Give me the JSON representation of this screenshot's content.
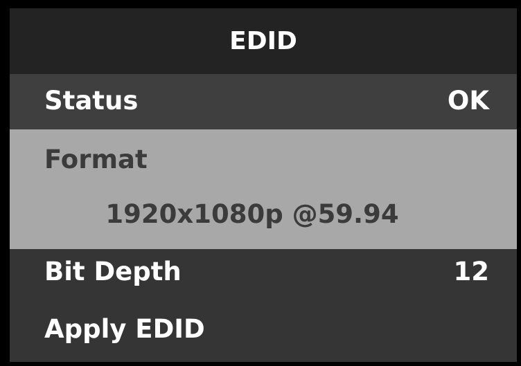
{
  "menu": {
    "title": "EDID",
    "status": {
      "label": "Status",
      "value": "OK"
    },
    "format": {
      "label": "Format",
      "value": "1920x1080p @59.94"
    },
    "bit_depth": {
      "label": "Bit Depth",
      "value": "12"
    },
    "apply": {
      "label": "Apply EDID"
    }
  },
  "colors": {
    "frame": "#000000",
    "header_bg": "#232323",
    "row_bg": "#353535",
    "status_row_bg": "#3f3f3f",
    "selected_row_bg": "#a8a8a8",
    "selected_text": "#3b3b3b",
    "text": "#ffffff"
  }
}
